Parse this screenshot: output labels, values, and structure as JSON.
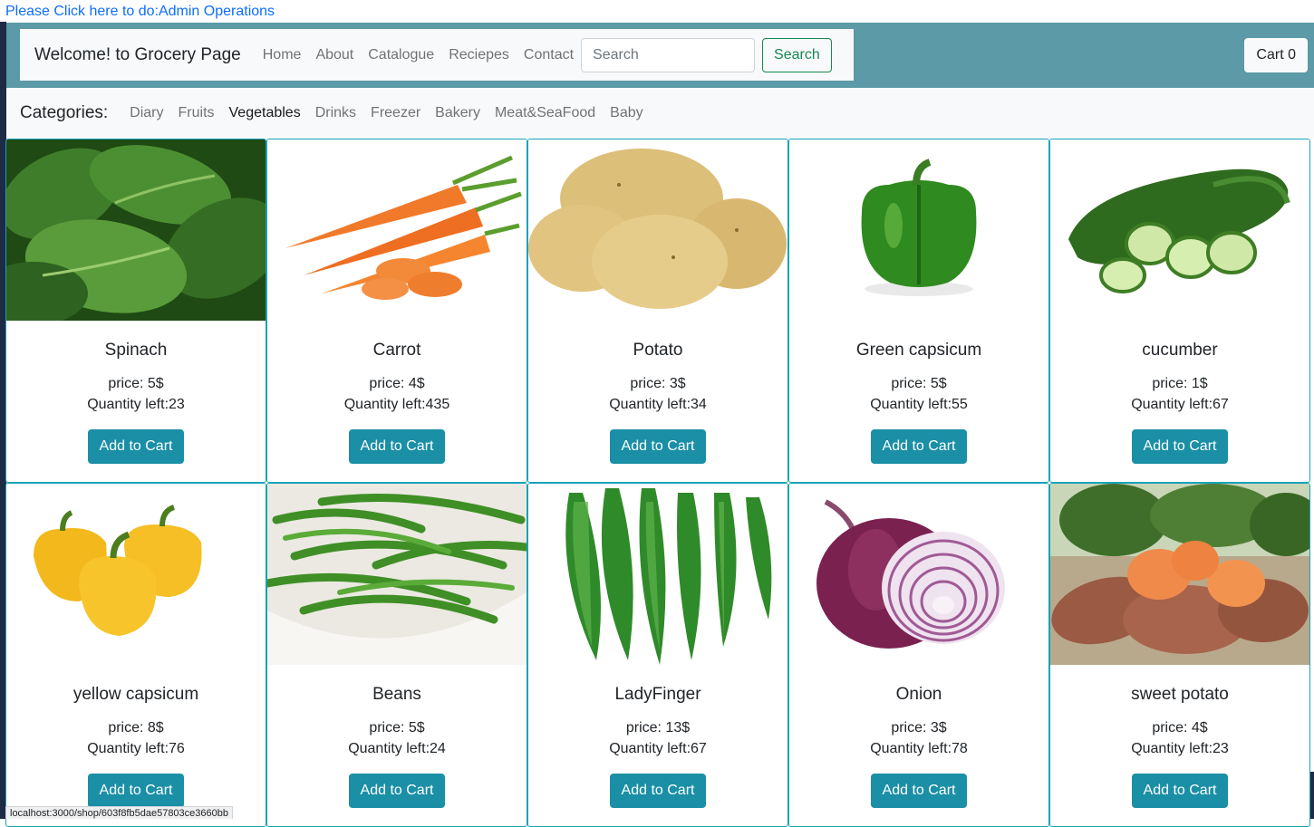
{
  "admin_link": "Please Click here to do:Admin Operations",
  "navbar": {
    "brand": "Welcome! to Grocery Page",
    "links": [
      "Home",
      "About",
      "Catalogue",
      "Reciepes",
      "Contact"
    ],
    "search_placeholder": "Search",
    "search_button": "Search",
    "cart": "Cart 0"
  },
  "categories": {
    "label": "Categories:",
    "items": [
      "Diary",
      "Fruits",
      "Vegetables",
      "Drinks",
      "Freezer",
      "Bakery",
      "Meat&SeaFood",
      "Baby"
    ],
    "active": "Vegetables"
  },
  "products": [
    {
      "name": "Spinach",
      "price": "price: 5$",
      "qty": "Quantity left:23",
      "button": "Add to Cart",
      "image": "spinach"
    },
    {
      "name": "Carrot",
      "price": "price: 4$",
      "qty": "Quantity left:435",
      "button": "Add to Cart",
      "image": "carrot"
    },
    {
      "name": "Potato",
      "price": "price: 3$",
      "qty": "Quantity left:34",
      "button": "Add to Cart",
      "image": "potato"
    },
    {
      "name": "Green capsicum",
      "price": "price: 5$",
      "qty": "Quantity left:55",
      "button": "Add to Cart",
      "image": "green-capsicum"
    },
    {
      "name": "cucumber",
      "price": "price: 1$",
      "qty": "Quantity left:67",
      "button": "Add to Cart",
      "image": "cucumber"
    },
    {
      "name": "yellow capsicum",
      "price": "price: 8$",
      "qty": "Quantity left:76",
      "button": "Add to Cart",
      "image": "yellow-capsicum"
    },
    {
      "name": "Beans",
      "price": "price: 5$",
      "qty": "Quantity left:24",
      "button": "Add to Cart",
      "image": "beans"
    },
    {
      "name": "LadyFinger",
      "price": "price: 13$",
      "qty": "Quantity left:67",
      "button": "Add to Cart",
      "image": "ladyfinger"
    },
    {
      "name": "Onion",
      "price": "price: 3$",
      "qty": "Quantity left:78",
      "button": "Add to Cart",
      "image": "onion"
    },
    {
      "name": "sweet potato",
      "price": "price: 4$",
      "qty": "Quantity left:23",
      "button": "Add to Cart",
      "image": "sweet-potato"
    }
  ],
  "status_url": "localhost:3000/shop/603f8fb5dae57803ce3660bb",
  "colors": {
    "topbar": "#5b9aa6",
    "card_border": "#17a2b8",
    "add_button": "#1a8fa6",
    "search_button": "#198754",
    "link": "#0d6efd"
  }
}
